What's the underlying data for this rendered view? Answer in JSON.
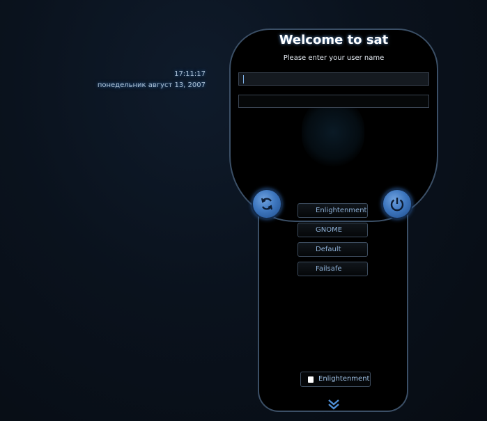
{
  "clock": {
    "time": "17:11:17",
    "date": "понедельник август 13, 2007"
  },
  "login": {
    "title": "Welcome to sat",
    "prompt": "Please enter your user name"
  },
  "buttons": {
    "refresh": "refresh-icon",
    "power": "power-icon"
  },
  "sessions": [
    "Enlightenment",
    "GNOME",
    "Default",
    "Failsafe"
  ],
  "current_session": "Enlightenment",
  "colors": {
    "accent": "#3e77bf",
    "text": "#8fb2d8"
  }
}
